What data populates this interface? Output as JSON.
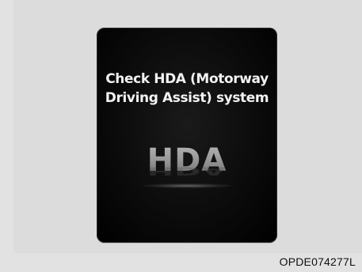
{
  "display": {
    "message_line1": "Check HDA (Motorway",
    "message_line2": "Driving Assist) system",
    "indicator_label": "HDA"
  },
  "figure": {
    "code": "OPDE074277L"
  },
  "colors": {
    "page_background": "#e2e2e2",
    "display_background": "#0a0a0a",
    "message_text": "#f2f2f2",
    "indicator_text": "#9a9a9a"
  }
}
